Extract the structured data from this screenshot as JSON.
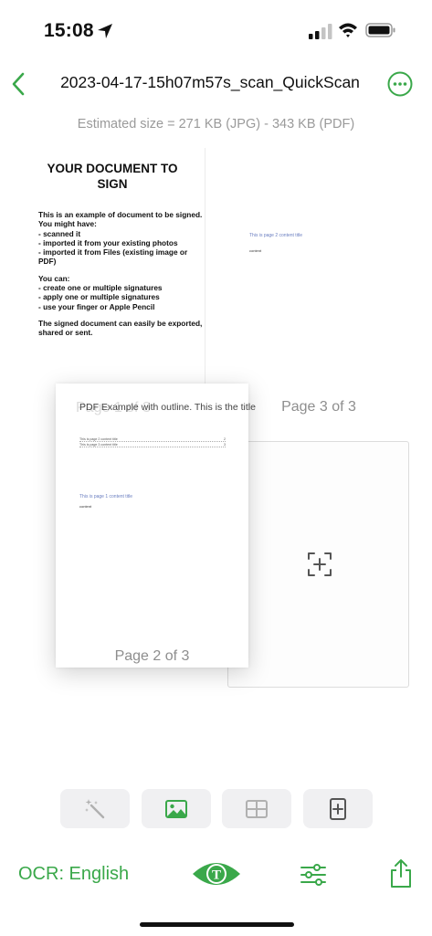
{
  "status_bar": {
    "time": "15:08"
  },
  "nav": {
    "title": "2023-04-17-15h07m57s_scan_QuickScan"
  },
  "estimated_size": "Estimated size = 271 KB (JPG) - 343 KB (PDF)",
  "pages": {
    "page1": {
      "heading": "YOUR DOCUMENT TO SIGN",
      "intro": "This is an example of document to be signed. You might have:",
      "list1": [
        "- scanned it",
        "- imported it from your existing photos",
        "- imported it from Files (existing image or PDF)"
      ],
      "you_can": "You can:",
      "list2": [
        "- create one or multiple signatures",
        "- apply one or multiple signatures",
        "- use your finger or Apple Pencil"
      ],
      "outro": "The signed document can easily be exported, shared or sent."
    },
    "page2": {
      "title": "PDF Example with outline. This is the title",
      "ghost": "Page 1 of 3",
      "toc": [
        {
          "label": "This is page 2 content title",
          "num": "2"
        },
        {
          "label": "This is page 3 content title",
          "num": "3"
        }
      ],
      "content_title": "This is page 1 content title",
      "content": "content",
      "label": "Page 2 of 3"
    },
    "page3": {
      "content_title": "This is page 2 content title",
      "content": "content",
      "label": "Page 3 of 3"
    }
  },
  "toolbar": {
    "buttons": [
      "magic-wand",
      "image",
      "grid-layout",
      "add-page"
    ]
  },
  "bottom_bar": {
    "ocr_label": "OCR: English",
    "ocr_icon_letter": "T"
  },
  "colors": {
    "accent": "#3aa84a",
    "tool_bg": "#f0f0f2"
  }
}
